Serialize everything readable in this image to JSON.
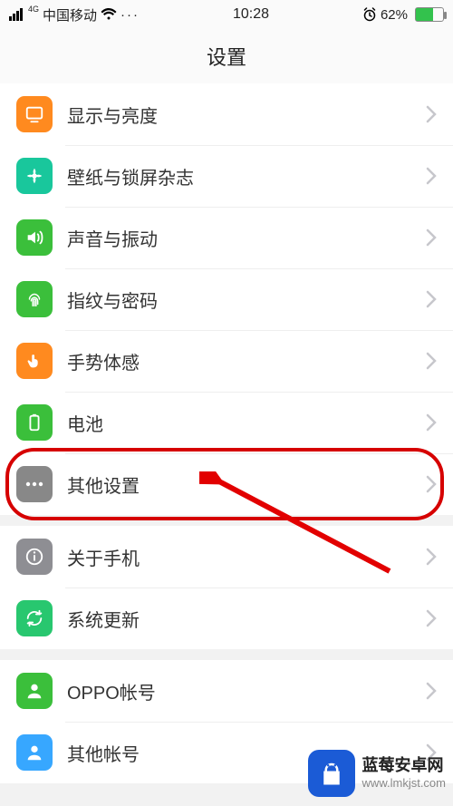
{
  "status": {
    "carrier": "中国移动",
    "network_prefix": "4G",
    "time": "10:28",
    "battery_pct": "62%",
    "more": "···"
  },
  "page": {
    "title": "设置"
  },
  "groups": [
    {
      "rows": [
        {
          "id": "display",
          "label": "显示与亮度",
          "icon": "display-icon",
          "color": "#ff8a1f"
        },
        {
          "id": "wallpaper",
          "label": "壁纸与锁屏杂志",
          "icon": "wallpaper-icon",
          "color": "#19c79c"
        },
        {
          "id": "sound",
          "label": "声音与振动",
          "icon": "sound-icon",
          "color": "#3bbf3b"
        },
        {
          "id": "fingerprint",
          "label": "指纹与密码",
          "icon": "fingerprint-icon",
          "color": "#3bbf3b"
        },
        {
          "id": "gesture",
          "label": "手势体感",
          "icon": "gesture-icon",
          "color": "#ff8a1f"
        },
        {
          "id": "battery",
          "label": "电池",
          "icon": "battery-icon",
          "color": "#3bbf3b"
        },
        {
          "id": "other",
          "label": "其他设置",
          "icon": "other-icon",
          "color": "#888888",
          "highlighted": true
        }
      ]
    },
    {
      "rows": [
        {
          "id": "about",
          "label": "关于手机",
          "icon": "about-icon",
          "color": "#8e8e93"
        },
        {
          "id": "update",
          "label": "系统更新",
          "icon": "update-icon",
          "color": "#28c76f"
        }
      ]
    },
    {
      "rows": [
        {
          "id": "oppo",
          "label": "OPPO帐号",
          "icon": "user-icon",
          "color": "#3bbf3b"
        },
        {
          "id": "otheracc",
          "label": "其他帐号",
          "icon": "user-icon",
          "color": "#37a7ff"
        }
      ]
    }
  ],
  "watermark": {
    "name": "蓝莓安卓网",
    "url": "www.lmkjst.com"
  }
}
